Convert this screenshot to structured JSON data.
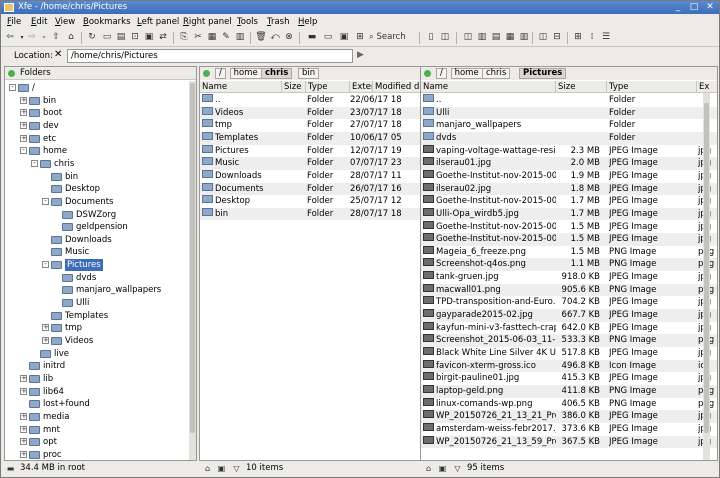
{
  "window": {
    "title": "Xfe - /home/chris/Pictures"
  },
  "menu": [
    "File",
    "Edit",
    "View",
    "Bookmarks",
    "Left panel",
    "Right panel",
    "Tools",
    "Trash",
    "Help"
  ],
  "toolbar": {
    "search_label": "Search"
  },
  "location": {
    "label": "Location:",
    "value": "/home/chris/Pictures"
  },
  "tree": {
    "header": "Folders",
    "items": [
      {
        "label": "/",
        "depth": 0,
        "exp": "-"
      },
      {
        "label": "bin",
        "depth": 1,
        "exp": "+"
      },
      {
        "label": "boot",
        "depth": 1,
        "exp": "+"
      },
      {
        "label": "dev",
        "depth": 1,
        "exp": "+"
      },
      {
        "label": "etc",
        "depth": 1,
        "exp": "+"
      },
      {
        "label": "home",
        "depth": 1,
        "exp": "-"
      },
      {
        "label": "chris",
        "depth": 2,
        "exp": "-"
      },
      {
        "label": "bin",
        "depth": 3,
        "exp": ""
      },
      {
        "label": "Desktop",
        "depth": 3,
        "exp": ""
      },
      {
        "label": "Documents",
        "depth": 3,
        "exp": "-"
      },
      {
        "label": "DSWZorg",
        "depth": 4,
        "exp": ""
      },
      {
        "label": "geldpension",
        "depth": 4,
        "exp": ""
      },
      {
        "label": "Downloads",
        "depth": 3,
        "exp": ""
      },
      {
        "label": "Music",
        "depth": 3,
        "exp": ""
      },
      {
        "label": "Pictures",
        "depth": 3,
        "exp": "-",
        "sel": true
      },
      {
        "label": "dvds",
        "depth": 4,
        "exp": ""
      },
      {
        "label": "manjaro_wallpapers",
        "depth": 4,
        "exp": ""
      },
      {
        "label": "Ulli",
        "depth": 4,
        "exp": ""
      },
      {
        "label": "Templates",
        "depth": 3,
        "exp": ""
      },
      {
        "label": "tmp",
        "depth": 3,
        "exp": "+"
      },
      {
        "label": "Videos",
        "depth": 3,
        "exp": "+"
      },
      {
        "label": "live",
        "depth": 2,
        "exp": ""
      },
      {
        "label": "initrd",
        "depth": 1,
        "exp": ""
      },
      {
        "label": "lib",
        "depth": 1,
        "exp": "+"
      },
      {
        "label": "lib64",
        "depth": 1,
        "exp": "+"
      },
      {
        "label": "lost+found",
        "depth": 1,
        "exp": ""
      },
      {
        "label": "media",
        "depth": 1,
        "exp": "+"
      },
      {
        "label": "mnt",
        "depth": 1,
        "exp": "+"
      },
      {
        "label": "opt",
        "depth": 1,
        "exp": "+"
      },
      {
        "label": "proc",
        "depth": 1,
        "exp": "+"
      }
    ]
  },
  "left_panel": {
    "path": [
      "/",
      "home",
      "chris",
      "bin"
    ],
    "active": "chris",
    "columns": [
      "Name",
      "Size",
      "Type",
      "Exter",
      "Modified da"
    ],
    "rows": [
      {
        "name": "..",
        "size": "",
        "type": "Folder",
        "date": "22/06/17 18"
      },
      {
        "name": "Videos",
        "size": "",
        "type": "Folder",
        "date": "23/07/17 18"
      },
      {
        "name": "tmp",
        "size": "",
        "type": "Folder",
        "date": "27/07/17 18"
      },
      {
        "name": "Templates",
        "size": "",
        "type": "Folder",
        "date": "10/06/17 05"
      },
      {
        "name": "Pictures",
        "size": "",
        "type": "Folder",
        "date": "12/07/17 19"
      },
      {
        "name": "Music",
        "size": "",
        "type": "Folder",
        "date": "07/07/17 23"
      },
      {
        "name": "Downloads",
        "size": "",
        "type": "Folder",
        "date": "28/07/17 11"
      },
      {
        "name": "Documents",
        "size": "",
        "type": "Folder",
        "date": "26/07/17 16"
      },
      {
        "name": "Desktop",
        "size": "",
        "type": "Folder",
        "date": "25/07/17 12"
      },
      {
        "name": "bin",
        "size": "",
        "type": "Folder",
        "date": "28/07/17 18"
      }
    ],
    "status": "10 items"
  },
  "right_panel": {
    "path": [
      "/",
      "home",
      "chris",
      "Pictures"
    ],
    "active": "Pictures",
    "columns": [
      "Name",
      "Size",
      "Type",
      "Ex"
    ],
    "rows": [
      {
        "name": "..",
        "size": "",
        "type": "Folder",
        "ext": ""
      },
      {
        "name": "Ulli",
        "size": "",
        "type": "Folder",
        "ext": ""
      },
      {
        "name": "manjaro_wallpapers",
        "size": "",
        "type": "Folder",
        "ext": ""
      },
      {
        "name": "dvds",
        "size": "",
        "type": "Folder",
        "ext": ""
      },
      {
        "name": "vaping-voltage-wattage-resis...",
        "size": "2.3 MB",
        "type": "JPEG Image",
        "ext": "jpg"
      },
      {
        "name": "ilserau01.jpg",
        "size": "2.0 MB",
        "type": "JPEG Image",
        "ext": "jpg"
      },
      {
        "name": "Goethe-Institut-nov-2015-00...",
        "size": "1.9 MB",
        "type": "JPEG Image",
        "ext": "jpg"
      },
      {
        "name": "ilserau02.jpg",
        "size": "1.8 MB",
        "type": "JPEG Image",
        "ext": "jpg"
      },
      {
        "name": "Goethe-Institut-nov-2015-00...",
        "size": "1.7 MB",
        "type": "JPEG Image",
        "ext": "jpg"
      },
      {
        "name": "Ulli-Opa_wirdb5.jpg",
        "size": "1.7 MB",
        "type": "JPEG Image",
        "ext": "jpg"
      },
      {
        "name": "Goethe-Institut-nov-2015-00...",
        "size": "1.5 MB",
        "type": "JPEG Image",
        "ext": "jpg"
      },
      {
        "name": "Goethe-Institut-nov-2015-00...",
        "size": "1.5 MB",
        "type": "JPEG Image",
        "ext": "jpg"
      },
      {
        "name": "Mageia_6_freeze.png",
        "size": "1.5 MB",
        "type": "PNG Image",
        "ext": "png"
      },
      {
        "name": "Screenshot-q4os.png",
        "size": "1.1 MB",
        "type": "PNG Image",
        "ext": "png"
      },
      {
        "name": "tank-gruen.jpg",
        "size": "918.0 KB",
        "type": "JPEG Image",
        "ext": "jpg"
      },
      {
        "name": "macwall01.png",
        "size": "905.6 KB",
        "type": "PNG Image",
        "ext": "png"
      },
      {
        "name": "TPD-transposition-and-Euro...",
        "size": "704.2 KB",
        "type": "JPEG Image",
        "ext": "jpg"
      },
      {
        "name": "gayparade2015-02.jpg",
        "size": "667.7 KB",
        "type": "JPEG Image",
        "ext": "jpg"
      },
      {
        "name": "kayfun-mini-v3-fasttech-crap...",
        "size": "642.0 KB",
        "type": "JPEG Image",
        "ext": "jpg"
      },
      {
        "name": "Screenshot_2015-06-03_11-1...",
        "size": "533.3 KB",
        "type": "PNG Image",
        "ext": "png"
      },
      {
        "name": "Black White Line Silver 4K Ult...",
        "size": "517.8 KB",
        "type": "JPEG Image",
        "ext": "jpg"
      },
      {
        "name": "favicon-xterm-gross.ico",
        "size": "496.8 KB",
        "type": "Icon Image",
        "ext": "ico"
      },
      {
        "name": "birgit-pauline01.jpg",
        "size": "415.3 KB",
        "type": "JPEG Image",
        "ext": "jpg"
      },
      {
        "name": "laptop-geld.png",
        "size": "411.8 KB",
        "type": "PNG Image",
        "ext": "png"
      },
      {
        "name": "linux-comands-wp.png",
        "size": "406.5 KB",
        "type": "PNG Image",
        "ext": "png"
      },
      {
        "name": "WP_20150726_21_13_21_Pro.j...",
        "size": "386.0 KB",
        "type": "JPEG Image",
        "ext": "jpg"
      },
      {
        "name": "amsterdam-weiss-febr2017.jpg",
        "size": "373.6 KB",
        "type": "JPEG Image",
        "ext": "jpg"
      },
      {
        "name": "WP_20150726_21_13_59_Pro.j...",
        "size": "367.5 KB",
        "type": "JPEG Image",
        "ext": "jpg"
      }
    ],
    "status": "95 items"
  },
  "tree_status": "34.4 MB in root"
}
